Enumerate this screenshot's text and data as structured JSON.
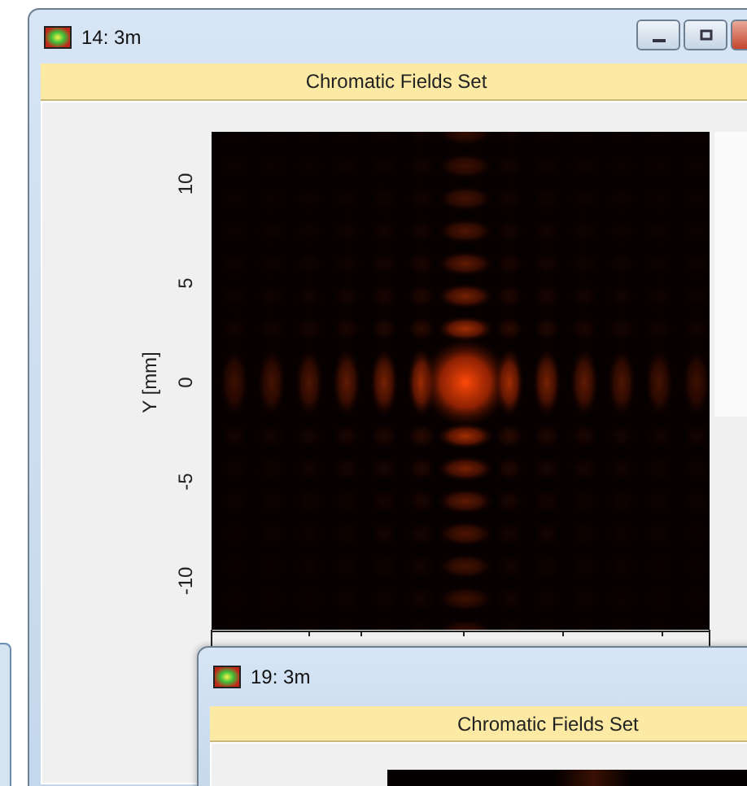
{
  "windows": [
    {
      "title": "14: 3m",
      "header": "Chromatic Fields Set",
      "plot": {
        "y_label": "Y [mm]",
        "y_ticks": [
          "10",
          "5",
          "0",
          "-5",
          "-10"
        ]
      }
    },
    {
      "title": "19: 3m",
      "header": "Chromatic Fields Set"
    }
  ]
}
